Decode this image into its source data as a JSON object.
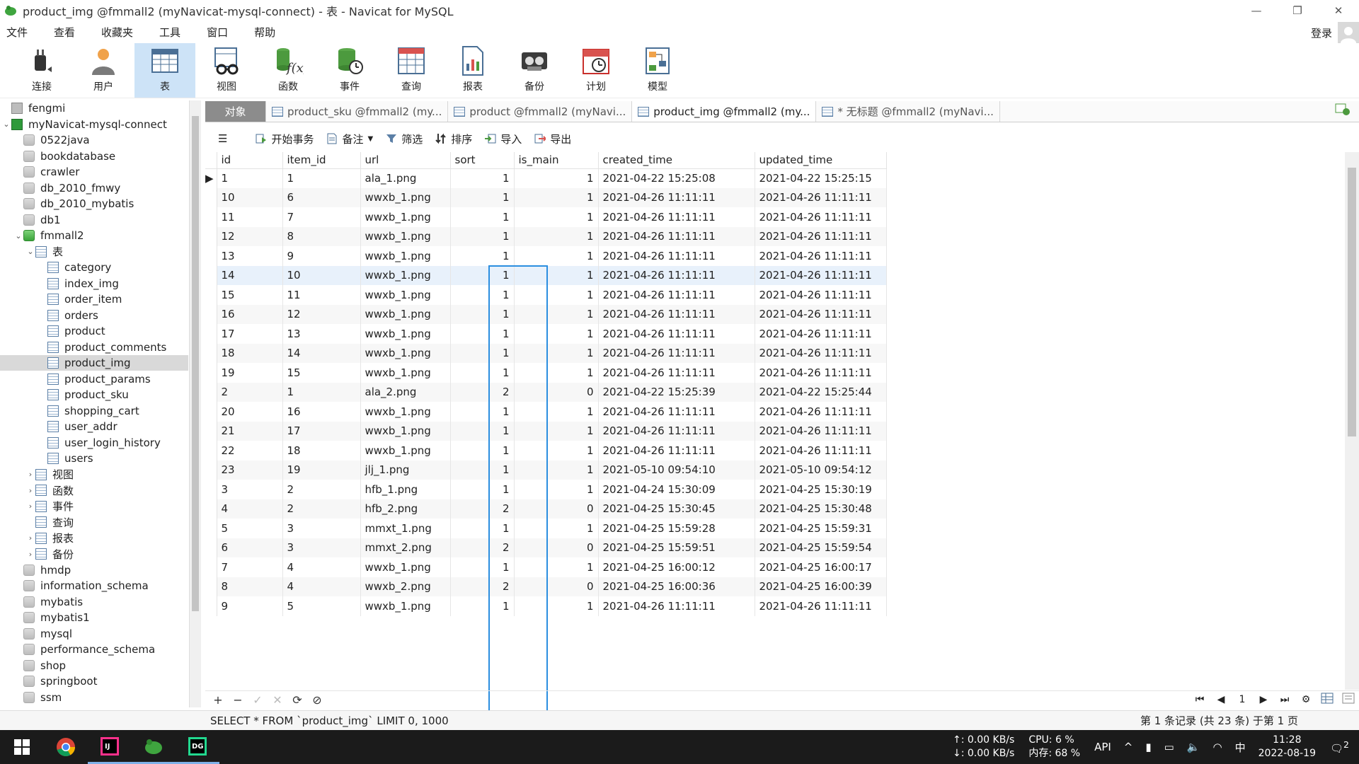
{
  "window": {
    "title": "product_img @fmmall2 (myNavicat-mysql-connect) - 表 - Navicat for MySQL",
    "min": "—",
    "max": "❐",
    "close": "✕"
  },
  "menu": [
    "文件",
    "查看",
    "收藏夹",
    "工具",
    "窗口",
    "帮助"
  ],
  "login_label": "登录",
  "toolbar": [
    {
      "label": "连接",
      "icon": "plug-icon"
    },
    {
      "label": "用户",
      "icon": "user-icon"
    },
    {
      "label": "表",
      "icon": "table-icon",
      "active": true
    },
    {
      "label": "视图",
      "icon": "view-icon"
    },
    {
      "label": "函数",
      "icon": "function-icon"
    },
    {
      "label": "事件",
      "icon": "event-icon"
    },
    {
      "label": "查询",
      "icon": "query-icon"
    },
    {
      "label": "报表",
      "icon": "report-icon"
    },
    {
      "label": "备份",
      "icon": "backup-icon"
    },
    {
      "label": "计划",
      "icon": "schedule-icon"
    },
    {
      "label": "模型",
      "icon": "model-icon"
    }
  ],
  "sidebar": {
    "rows": [
      {
        "label": "fengmi",
        "icon": "conn-grey",
        "indent": 0
      },
      {
        "label": "myNavicat-mysql-connect",
        "icon": "conn-green",
        "indent": 0,
        "arrow": "open"
      },
      {
        "label": "0522java",
        "icon": "db",
        "indent": 1
      },
      {
        "label": "bookdatabase",
        "icon": "db",
        "indent": 1
      },
      {
        "label": "crawler",
        "icon": "db",
        "indent": 1
      },
      {
        "label": "db_2010_fmwy",
        "icon": "db",
        "indent": 1
      },
      {
        "label": "db_2010_mybatis",
        "icon": "db",
        "indent": 1
      },
      {
        "label": "db1",
        "icon": "db",
        "indent": 1
      },
      {
        "label": "fmmall2",
        "icon": "db-green",
        "indent": 1,
        "arrow": "open"
      },
      {
        "label": "表",
        "icon": "table",
        "indent": 2,
        "arrow": "open"
      },
      {
        "label": "category",
        "icon": "table",
        "indent": 3
      },
      {
        "label": "index_img",
        "icon": "table",
        "indent": 3
      },
      {
        "label": "order_item",
        "icon": "table",
        "indent": 3
      },
      {
        "label": "orders",
        "icon": "table",
        "indent": 3
      },
      {
        "label": "product",
        "icon": "table",
        "indent": 3
      },
      {
        "label": "product_comments",
        "icon": "table",
        "indent": 3
      },
      {
        "label": "product_img",
        "icon": "table",
        "indent": 3,
        "selected": true
      },
      {
        "label": "product_params",
        "icon": "table",
        "indent": 3
      },
      {
        "label": "product_sku",
        "icon": "table",
        "indent": 3
      },
      {
        "label": "shopping_cart",
        "icon": "table",
        "indent": 3
      },
      {
        "label": "user_addr",
        "icon": "table",
        "indent": 3
      },
      {
        "label": "user_login_history",
        "icon": "table",
        "indent": 3
      },
      {
        "label": "users",
        "icon": "table",
        "indent": 3
      },
      {
        "label": "视图",
        "icon": "view",
        "indent": 2,
        "arrow": "closed"
      },
      {
        "label": "函数",
        "icon": "function",
        "indent": 2,
        "arrow": "closed"
      },
      {
        "label": "事件",
        "icon": "event",
        "indent": 2,
        "arrow": "closed"
      },
      {
        "label": "查询",
        "icon": "query",
        "indent": 2
      },
      {
        "label": "报表",
        "icon": "report",
        "indent": 2,
        "arrow": "closed"
      },
      {
        "label": "备份",
        "icon": "backup",
        "indent": 2,
        "arrow": "closed"
      },
      {
        "label": "hmdp",
        "icon": "db",
        "indent": 1
      },
      {
        "label": "information_schema",
        "icon": "db",
        "indent": 1
      },
      {
        "label": "mybatis",
        "icon": "db",
        "indent": 1
      },
      {
        "label": "mybatis1",
        "icon": "db",
        "indent": 1
      },
      {
        "label": "mysql",
        "icon": "db",
        "indent": 1
      },
      {
        "label": "performance_schema",
        "icon": "db",
        "indent": 1
      },
      {
        "label": "shop",
        "icon": "db",
        "indent": 1
      },
      {
        "label": "springboot",
        "icon": "db",
        "indent": 1
      },
      {
        "label": "ssm",
        "icon": "db",
        "indent": 1
      }
    ]
  },
  "tabs": [
    {
      "label": "对象",
      "kind": "obj"
    },
    {
      "label": "product_sku @fmmall2 (my...",
      "kind": "table"
    },
    {
      "label": "product @fmmall2 (myNavi...",
      "kind": "table"
    },
    {
      "label": "product_img @fmmall2 (my...",
      "kind": "table",
      "active": true
    },
    {
      "label": "* 无标题 @fmmall2 (myNavi...",
      "kind": "query"
    }
  ],
  "grid_toolbar": {
    "menu": "☰",
    "begin_tx": "开始事务",
    "note": "备注",
    "filter": "筛选",
    "sort": "排序",
    "import": "导入",
    "export": "导出"
  },
  "table": {
    "columns": [
      "id",
      "item_id",
      "url",
      "sort",
      "is_main",
      "created_time",
      "updated_time"
    ],
    "rows": [
      [
        "1",
        "1",
        "ala_1.png",
        "1",
        "1",
        "2021-04-22 15:25:08",
        "2021-04-22 15:25:15"
      ],
      [
        "10",
        "6",
        "wwxb_1.png",
        "1",
        "1",
        "2021-04-26 11:11:11",
        "2021-04-26 11:11:11"
      ],
      [
        "11",
        "7",
        "wwxb_1.png",
        "1",
        "1",
        "2021-04-26 11:11:11",
        "2021-04-26 11:11:11"
      ],
      [
        "12",
        "8",
        "wwxb_1.png",
        "1",
        "1",
        "2021-04-26 11:11:11",
        "2021-04-26 11:11:11"
      ],
      [
        "13",
        "9",
        "wwxb_1.png",
        "1",
        "1",
        "2021-04-26 11:11:11",
        "2021-04-26 11:11:11"
      ],
      [
        "14",
        "10",
        "wwxb_1.png",
        "1",
        "1",
        "2021-04-26 11:11:11",
        "2021-04-26 11:11:11"
      ],
      [
        "15",
        "11",
        "wwxb_1.png",
        "1",
        "1",
        "2021-04-26 11:11:11",
        "2021-04-26 11:11:11"
      ],
      [
        "16",
        "12",
        "wwxb_1.png",
        "1",
        "1",
        "2021-04-26 11:11:11",
        "2021-04-26 11:11:11"
      ],
      [
        "17",
        "13",
        "wwxb_1.png",
        "1",
        "1",
        "2021-04-26 11:11:11",
        "2021-04-26 11:11:11"
      ],
      [
        "18",
        "14",
        "wwxb_1.png",
        "1",
        "1",
        "2021-04-26 11:11:11",
        "2021-04-26 11:11:11"
      ],
      [
        "19",
        "15",
        "wwxb_1.png",
        "1",
        "1",
        "2021-04-26 11:11:11",
        "2021-04-26 11:11:11"
      ],
      [
        "2",
        "1",
        "ala_2.png",
        "2",
        "0",
        "2021-04-22 15:25:39",
        "2021-04-22 15:25:44"
      ],
      [
        "20",
        "16",
        "wwxb_1.png",
        "1",
        "1",
        "2021-04-26 11:11:11",
        "2021-04-26 11:11:11"
      ],
      [
        "21",
        "17",
        "wwxb_1.png",
        "1",
        "1",
        "2021-04-26 11:11:11",
        "2021-04-26 11:11:11"
      ],
      [
        "22",
        "18",
        "wwxb_1.png",
        "1",
        "1",
        "2021-04-26 11:11:11",
        "2021-04-26 11:11:11"
      ],
      [
        "23",
        "19",
        "jlj_1.png",
        "1",
        "1",
        "2021-05-10 09:54:10",
        "2021-05-10 09:54:12"
      ],
      [
        "3",
        "2",
        "hfb_1.png",
        "1",
        "1",
        "2021-04-24 15:30:09",
        "2021-04-25 15:30:19"
      ],
      [
        "4",
        "2",
        "hfb_2.png",
        "2",
        "0",
        "2021-04-25 15:30:45",
        "2021-04-25 15:30:48"
      ],
      [
        "5",
        "3",
        "mmxt_1.png",
        "1",
        "1",
        "2021-04-25 15:59:28",
        "2021-04-25 15:59:31"
      ],
      [
        "6",
        "3",
        "mmxt_2.png",
        "2",
        "0",
        "2021-04-25 15:59:51",
        "2021-04-25 15:59:54"
      ],
      [
        "7",
        "4",
        "wwxb_1.png",
        "1",
        "1",
        "2021-04-25 16:00:12",
        "2021-04-25 16:00:17"
      ],
      [
        "8",
        "4",
        "wwxb_2.png",
        "2",
        "0",
        "2021-04-25 16:00:36",
        "2021-04-25 16:00:39"
      ],
      [
        "9",
        "5",
        "wwxb_1.png",
        "1",
        "1",
        "2021-04-26 11:11:11",
        "2021-04-26 11:11:11"
      ]
    ]
  },
  "bottom_toolbar": {
    "add": "+",
    "remove": "−",
    "apply": "✓",
    "discard": "✕",
    "refresh": "⟳",
    "stop": "⊘"
  },
  "pager": {
    "first": "⏮",
    "prev": "◀",
    "page": "1",
    "next": "▶",
    "last": "⏭",
    "settings": "⚙"
  },
  "status": {
    "sql": "SELECT * FROM `product_img` LIMIT 0, 1000",
    "records": "第 1 条记录 (共 23 条) 于第 1 页"
  },
  "taskbar": {
    "up": "↑: 0.00 KB/s",
    "down": "↓: 0.00 KB/s",
    "cpu": "CPU: 6 %",
    "mem": "内存: 68 %",
    "api": "API",
    "ime": "中",
    "time": "11:28",
    "date": "2022-08-19",
    "notif": "2"
  },
  "colors": {
    "highlight_box": "#2b8ee0",
    "active_tool": "#cde3f7"
  }
}
